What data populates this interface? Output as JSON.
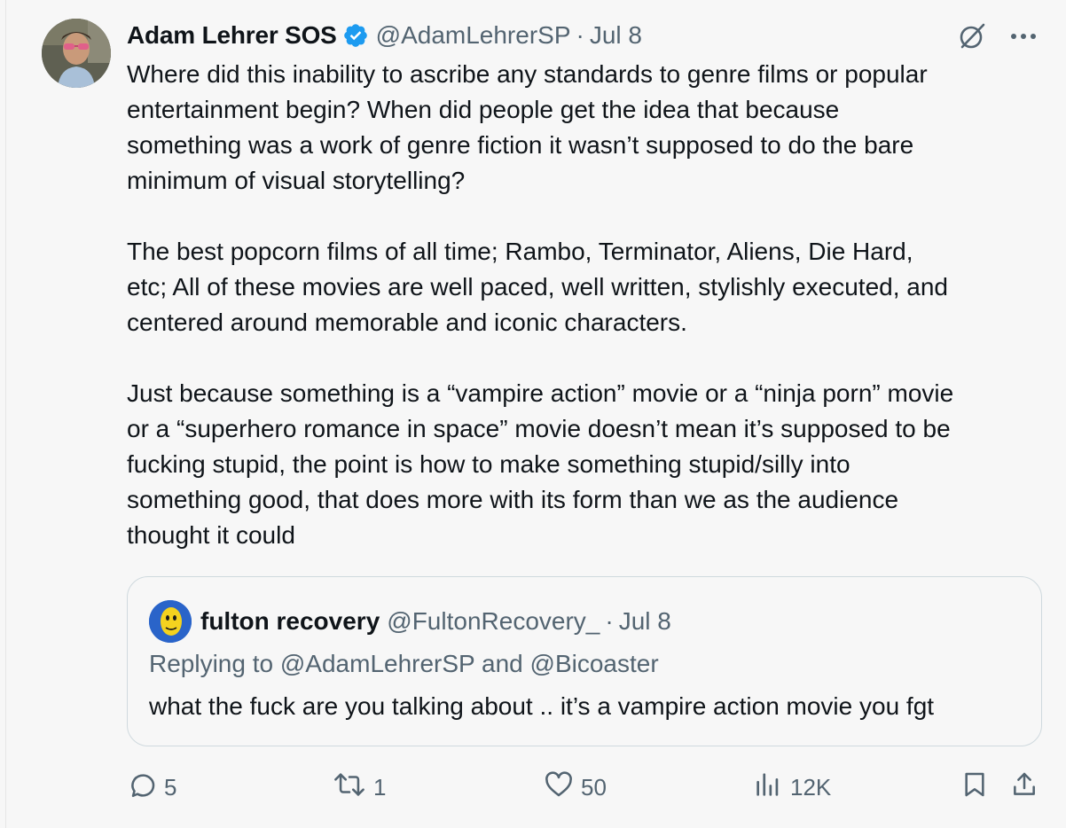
{
  "author": {
    "name": "Adam Lehrer SOS",
    "handle": "@AdamLehrerSP",
    "date": "Jul 8",
    "separator": "·"
  },
  "tweet_text": "Where did this inability to ascribe any standards to genre films or popular\nentertainment begin? When did people get the idea that because\nsomething was a work of genre fiction it wasn’t supposed to do the bare\nminimum of visual storytelling?\n\nThe best popcorn films of all time; Rambo, Terminator, Aliens, Die Hard,\netc; All of these movies are well paced, well written, stylishly executed, and\ncentered around memorable and iconic characters.\n\nJust because something is a “vampire action” movie or a “ninja porn” movie\nor a “superhero romance in space” movie doesn’t mean it’s supposed to be\nfucking stupid, the point is how to make something stupid/silly into\nsomething good, that does more with its form than we as the audience\nthought it could",
  "quote": {
    "name": "fulton recovery",
    "handle": "@FultonRecovery_",
    "separator": "·",
    "date": "Jul 8",
    "replying_prefix": "Replying to ",
    "replying_user1": "@AdamLehrerSP",
    "replying_and": " and ",
    "replying_user2": "@Bicoaster",
    "text": "what the fuck are you talking about .. it’s a vampire action movie you fgt"
  },
  "actions": {
    "replies": "5",
    "retweets": "1",
    "likes": "50",
    "views": "12K"
  },
  "colors": {
    "text": "#0f1419",
    "secondary": "#536471",
    "verified": "#1d9bf0",
    "border": "#cfd9de"
  },
  "icons": [
    "verified-badge-icon",
    "grok-icon",
    "more-icon",
    "reply-icon",
    "retweet-icon",
    "like-icon",
    "views-icon",
    "bookmark-icon",
    "share-icon"
  ]
}
